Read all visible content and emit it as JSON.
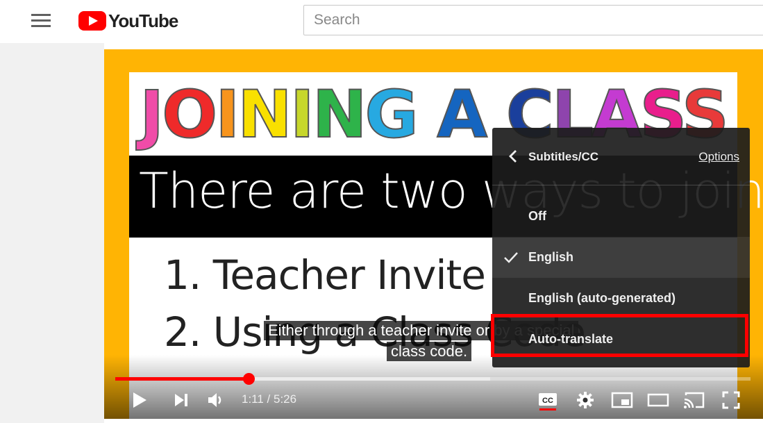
{
  "header": {
    "logo_text": "YouTube",
    "search_placeholder": "Search"
  },
  "video": {
    "slide_title_letters": [
      {
        "ch": "J",
        "color": "#f04ca8"
      },
      {
        "ch": "O",
        "color": "#ef2a2a"
      },
      {
        "ch": "I",
        "color": "#f7941d"
      },
      {
        "ch": "N",
        "color": "#f9e000"
      },
      {
        "ch": "I",
        "color": "#c7d72b"
      },
      {
        "ch": "N",
        "color": "#2eb34a"
      },
      {
        "ch": "G",
        "color": "#27a9e1"
      },
      {
        "ch": " ",
        "color": "#000000"
      },
      {
        "ch": "A",
        "color": "#1565c0"
      },
      {
        "ch": " ",
        "color": "#000000"
      },
      {
        "ch": "C",
        "color": "#1a3f9c"
      },
      {
        "ch": "L",
        "color": "#8e44ad"
      },
      {
        "ch": "A",
        "color": "#c43bd1"
      },
      {
        "ch": "S",
        "color": "#e91e8c"
      },
      {
        "ch": "S",
        "color": "#e83a3a"
      }
    ],
    "band_text": "There are two ways to join!",
    "list_item_1": "1.   Teacher Invite",
    "list_item_2": "2.  Using a Class Code",
    "captions": {
      "line1": "Either through a teacher invite or by a special",
      "line2": "class code."
    },
    "progress_played_fraction": 0.21,
    "progress_buffered_fraction": 0.59,
    "time": {
      "current": "1:11",
      "duration": "5:26",
      "display": "1:11 / 5:26"
    }
  },
  "settings_menu": {
    "title": "Subtitles/CC",
    "options_link": "Options",
    "items": [
      {
        "label": "Off",
        "selected": false
      },
      {
        "label": "English",
        "selected": true
      },
      {
        "label": "English (auto-generated)",
        "selected": false
      },
      {
        "label": "Auto-translate",
        "selected": false
      }
    ],
    "highlighted_item": "Auto-translate"
  },
  "colors": {
    "accent": "#ff0000",
    "player_border": "#ffb404",
    "menu_bg": "#1c1c1c"
  },
  "icons": [
    "menu-icon",
    "youtube-logo-icon",
    "play-icon",
    "next-icon",
    "volume-icon",
    "cc-icon",
    "settings-gear-icon",
    "miniplayer-icon",
    "theater-mode-icon",
    "cast-icon",
    "fullscreen-icon",
    "chevron-left-icon",
    "checkmark-icon"
  ]
}
